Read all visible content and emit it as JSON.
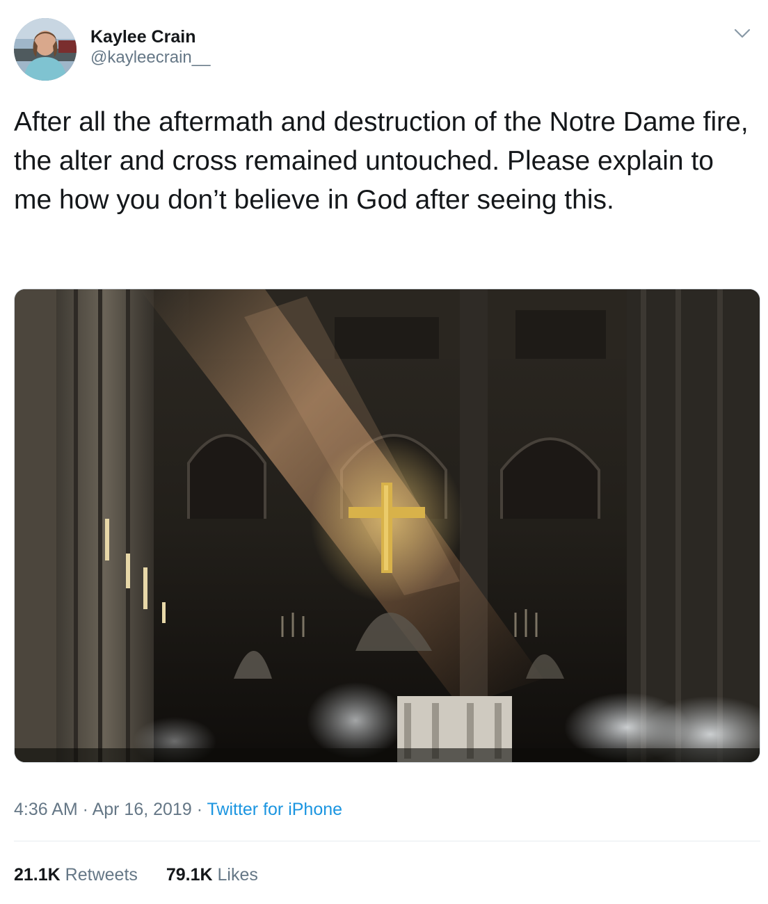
{
  "tweet": {
    "author": {
      "display_name": "Kaylee Crain",
      "handle": "@kayleecrain__",
      "avatar_icon": "profile-photo"
    },
    "menu_icon": "chevron-down-icon",
    "text": "After all the aftermath and destruction of the Notre Dame fire, the alter and cross remained untouched. Please explain to me how you don’t believe in God after seeing this.",
    "time": "4:36 AM",
    "separator": " · ",
    "date": "Apr 16, 2019",
    "source": "Twitter for iPhone",
    "stats": {
      "retweets_count": "21.1K",
      "retweets_label": "Retweets",
      "likes_count": "79.1K",
      "likes_label": "Likes"
    }
  },
  "colors": {
    "text": "#14171a",
    "secondary": "#657786",
    "link": "#1b95e0",
    "divider": "#e6ecf0"
  }
}
